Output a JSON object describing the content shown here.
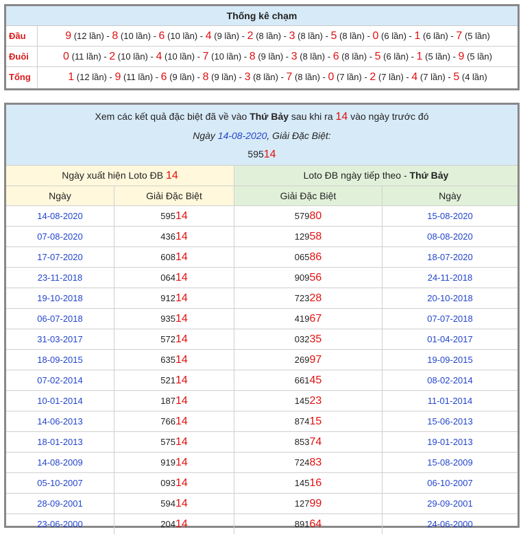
{
  "cham": {
    "title": "Thống kê chạm",
    "rows": [
      {
        "label": "Đầu",
        "items": [
          [
            "9",
            "(12 lần)"
          ],
          [
            "8",
            "(10 lần)"
          ],
          [
            "6",
            "(10 lần)"
          ],
          [
            "4",
            "(9 lần)"
          ],
          [
            "2",
            "(8 lần)"
          ],
          [
            "3",
            "(8 lần)"
          ],
          [
            "5",
            "(8 lần)"
          ],
          [
            "0",
            "(6 lần)"
          ],
          [
            "1",
            "(6 lần)"
          ],
          [
            "7",
            "(5 lần)"
          ]
        ]
      },
      {
        "label": "Đuôi",
        "items": [
          [
            "0",
            "(11 lần)"
          ],
          [
            "2",
            "(10 lần)"
          ],
          [
            "4",
            "(10 lần)"
          ],
          [
            "7",
            "(10 lần)"
          ],
          [
            "8",
            "(9 lần)"
          ],
          [
            "3",
            "(8 lần)"
          ],
          [
            "6",
            "(8 lần)"
          ],
          [
            "5",
            "(6 lần)"
          ],
          [
            "1",
            "(5 lần)"
          ],
          [
            "9",
            "(5 lần)"
          ]
        ]
      },
      {
        "label": "Tổng",
        "items": [
          [
            "1",
            "(12 lần)"
          ],
          [
            "9",
            "(11 lần)"
          ],
          [
            "6",
            "(9 lần)"
          ],
          [
            "8",
            "(9 lần)"
          ],
          [
            "3",
            "(8 lần)"
          ],
          [
            "7",
            "(8 lần)"
          ],
          [
            "0",
            "(7 lần)"
          ],
          [
            "2",
            "(7 lần)"
          ],
          [
            "4",
            "(7 lần)"
          ],
          [
            "5",
            "(4 lần)"
          ]
        ]
      }
    ]
  },
  "header": {
    "line1_pre": "Xem các kết quả đặc biệt đã về vào",
    "day": "Thứ Bảy",
    "line1_mid": "sau khi ra",
    "loto": "14",
    "line1_post": "vào ngày trước đó",
    "line2_pre": "Ngày",
    "date": "14-08-2020",
    "line2_post": ", Giải Đặc Biệt:",
    "special_head": "595",
    "special_tail": "14"
  },
  "sub": {
    "left_pre": "Ngày xuất hiện Loto ĐB",
    "left_num": "14",
    "right_pre": "Loto ĐB ngày tiếp theo -",
    "right_day": "Thứ Bảy"
  },
  "columns": [
    "Ngày",
    "Giải Đặc Biệt",
    "Giải Đặc Biệt",
    "Ngày"
  ],
  "rows": [
    {
      "d1": "14-08-2020",
      "g1a": "595",
      "g1b": "14",
      "g2a": "579",
      "g2b": "80",
      "d2": "15-08-2020"
    },
    {
      "d1": "07-08-2020",
      "g1a": "436",
      "g1b": "14",
      "g2a": "129",
      "g2b": "58",
      "d2": "08-08-2020"
    },
    {
      "d1": "17-07-2020",
      "g1a": "608",
      "g1b": "14",
      "g2a": "065",
      "g2b": "86",
      "d2": "18-07-2020"
    },
    {
      "d1": "23-11-2018",
      "g1a": "064",
      "g1b": "14",
      "g2a": "909",
      "g2b": "56",
      "d2": "24-11-2018"
    },
    {
      "d1": "19-10-2018",
      "g1a": "912",
      "g1b": "14",
      "g2a": "723",
      "g2b": "28",
      "d2": "20-10-2018"
    },
    {
      "d1": "06-07-2018",
      "g1a": "935",
      "g1b": "14",
      "g2a": "419",
      "g2b": "67",
      "d2": "07-07-2018"
    },
    {
      "d1": "31-03-2017",
      "g1a": "572",
      "g1b": "14",
      "g2a": "032",
      "g2b": "35",
      "d2": "01-04-2017"
    },
    {
      "d1": "18-09-2015",
      "g1a": "635",
      "g1b": "14",
      "g2a": "269",
      "g2b": "97",
      "d2": "19-09-2015"
    },
    {
      "d1": "07-02-2014",
      "g1a": "521",
      "g1b": "14",
      "g2a": "661",
      "g2b": "45",
      "d2": "08-02-2014"
    },
    {
      "d1": "10-01-2014",
      "g1a": "187",
      "g1b": "14",
      "g2a": "145",
      "g2b": "23",
      "d2": "11-01-2014"
    },
    {
      "d1": "14-06-2013",
      "g1a": "766",
      "g1b": "14",
      "g2a": "874",
      "g2b": "15",
      "d2": "15-06-2013"
    },
    {
      "d1": "18-01-2013",
      "g1a": "575",
      "g1b": "14",
      "g2a": "853",
      "g2b": "74",
      "d2": "19-01-2013"
    },
    {
      "d1": "14-08-2009",
      "g1a": "919",
      "g1b": "14",
      "g2a": "724",
      "g2b": "83",
      "d2": "15-08-2009"
    },
    {
      "d1": "05-10-2007",
      "g1a": "093",
      "g1b": "14",
      "g2a": "145",
      "g2b": "16",
      "d2": "06-10-2007"
    },
    {
      "d1": "28-09-2001",
      "g1a": "594",
      "g1b": "14",
      "g2a": "127",
      "g2b": "99",
      "d2": "29-09-2001"
    },
    {
      "d1": "23-06-2000",
      "g1a": "204",
      "g1b": "14",
      "g2a": "891",
      "g2b": "64",
      "d2": "24-06-2000"
    }
  ]
}
